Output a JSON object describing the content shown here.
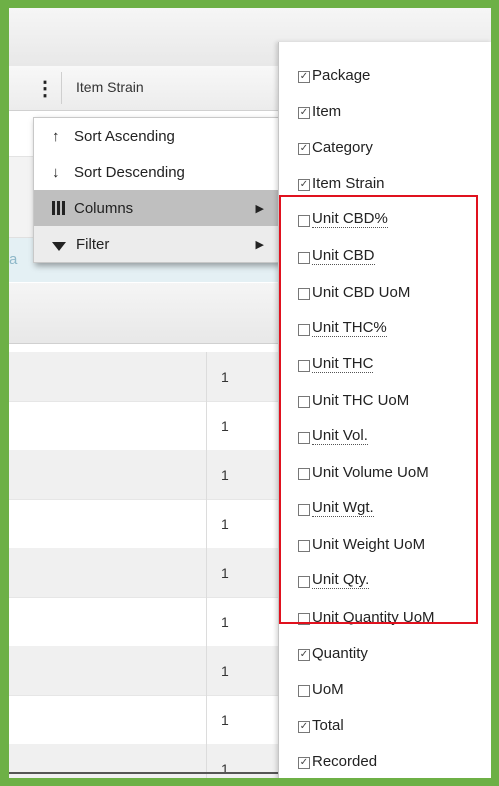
{
  "header": {
    "column_label": "Item Strain"
  },
  "left_stub_text": "a",
  "context_menu": {
    "items": [
      {
        "icon": "arrow-up-icon",
        "glyph": "↑",
        "label": "Sort Ascending"
      },
      {
        "icon": "arrow-down-icon",
        "glyph": "↓",
        "label": "Sort Descending"
      },
      {
        "icon": "columns-icon",
        "label": "Columns"
      },
      {
        "icon": "filter-icon",
        "label": "Filter"
      }
    ],
    "submenu_arrow": "▶"
  },
  "grid": {
    "values": [
      "1",
      "1",
      "1",
      "1",
      "1",
      "1",
      "1",
      "1",
      "1"
    ]
  },
  "columns_panel": {
    "options": [
      {
        "label": "Package",
        "checked": true
      },
      {
        "label": "Item",
        "checked": true
      },
      {
        "label": "Category",
        "checked": true
      },
      {
        "label": "Item Strain",
        "checked": true
      },
      {
        "label": "Unit CBD%",
        "checked": false
      },
      {
        "label": "Unit CBD",
        "checked": false
      },
      {
        "label": "Unit CBD UoM",
        "checked": false
      },
      {
        "label": "Unit THC%",
        "checked": false
      },
      {
        "label": "Unit THC",
        "checked": false
      },
      {
        "label": "Unit THC UoM",
        "checked": false
      },
      {
        "label": "Unit Vol.",
        "checked": false
      },
      {
        "label": "Unit Volume UoM",
        "checked": false
      },
      {
        "label": "Unit Wgt.",
        "checked": false
      },
      {
        "label": "Unit Weight UoM",
        "checked": false
      },
      {
        "label": "Unit Qty.",
        "checked": false
      },
      {
        "label": "Unit Quantity UoM",
        "checked": false
      },
      {
        "label": "Quantity",
        "checked": true
      },
      {
        "label": "UoM",
        "checked": false
      },
      {
        "label": "Total",
        "checked": true
      },
      {
        "label": "Recorded",
        "checked": true
      }
    ],
    "checkmark": "✓",
    "highlight_color": "#e0111e"
  }
}
